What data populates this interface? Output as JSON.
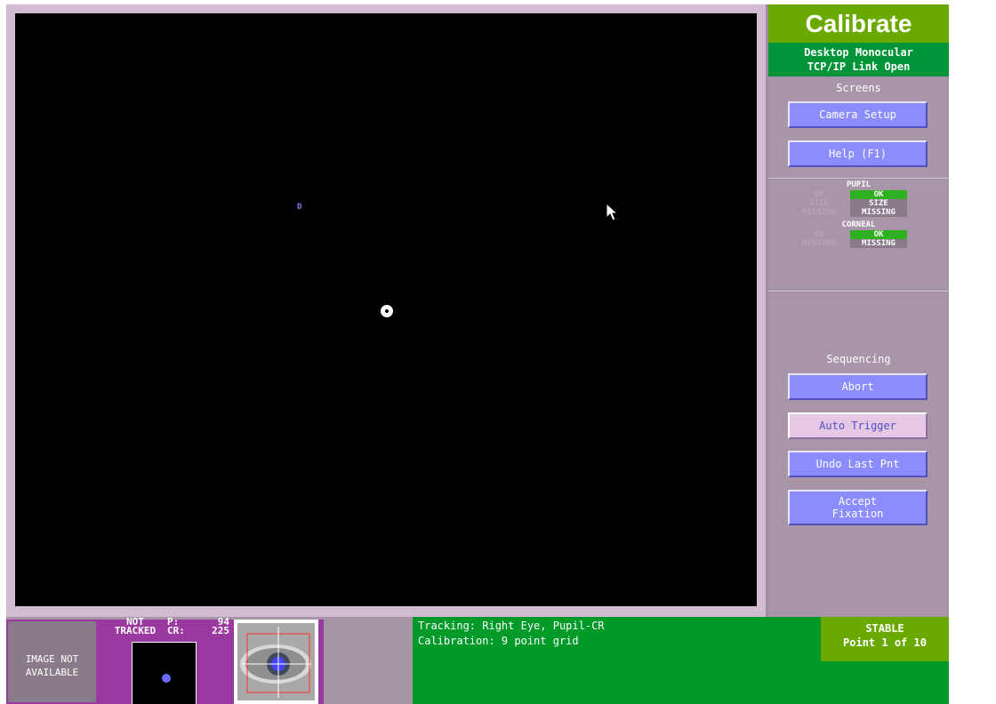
{
  "header": {
    "mode_title": "Calibrate",
    "status_line1": "Desktop Monocular",
    "status_line2": "TCP/IP Link Open"
  },
  "display": {
    "marker_glyph": "D"
  },
  "screens": {
    "label": "Screens",
    "camera_setup": "Camera Setup",
    "help": "Help (F1)"
  },
  "indicators": {
    "pupil_label": "PUPIL",
    "corneal_label": "CORNEAL",
    "pupil_left": [
      "OK",
      "SIZE",
      "MISSING"
    ],
    "pupil_right": [
      "OK",
      "SIZE",
      "MISSING"
    ],
    "corneal_left": [
      "OK",
      "MISSING"
    ],
    "corneal_right": [
      "OK",
      "MISSING"
    ],
    "colors": {
      "active": "#2fb020",
      "inactive": "#8a7a8a"
    }
  },
  "sequencing": {
    "label": "Sequencing",
    "abort": "Abort",
    "auto_trigger": "Auto Trigger",
    "undo": "Undo Last Pnt",
    "accept_line1": "Accept",
    "accept_line2": "Fixation"
  },
  "bottom": {
    "image_na_line1": "IMAGE NOT",
    "image_na_line2": "AVAILABLE",
    "not_tracked_line1": "NOT",
    "not_tracked_line2": "TRACKED",
    "p_label": "P:",
    "p_value": "94",
    "cr_label": "CR:",
    "cr_value": "225",
    "tracking_line": "Tracking:  Right Eye, Pupil-CR",
    "calibration_line": "Calibration: 9 point grid",
    "stable_label": "STABLE",
    "point_progress": "Point 1 of 10"
  }
}
